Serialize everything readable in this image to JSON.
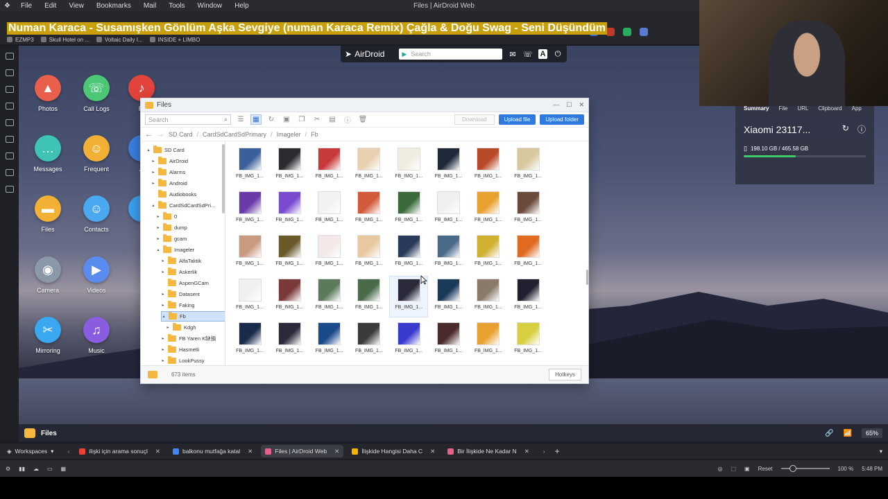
{
  "menubar": {
    "items": [
      "File",
      "Edit",
      "View",
      "Bookmarks",
      "Mail",
      "Tools",
      "Window",
      "Help"
    ],
    "window_title": "Files | AirDroid Web"
  },
  "overlay_text": "Numan Karaca - Susamışken Gönlüm Aşka Sevgiye (numan Karaca Remix) Çağla & Doğu Swag - Seni Düşündüm",
  "bookmarks": [
    "EZMP3",
    "Skull Hotel on ...",
    "Voltaic Daily I...",
    "INSIDE + LIMBO"
  ],
  "airdroid_bar": {
    "brand": "AirDroid",
    "search_placeholder": "Search"
  },
  "desktop_apps": [
    {
      "label": "Photos",
      "color": "#e8604c",
      "glyph": "▲"
    },
    {
      "label": "Call Logs",
      "color": "#4cc776",
      "glyph": "☏"
    },
    {
      "label": "Ri",
      "color": "#e2433a",
      "glyph": "♪"
    },
    {
      "label": "Messages",
      "color": "#3fc3b4",
      "glyph": "…"
    },
    {
      "label": "Frequent",
      "color": "#f2b035",
      "glyph": "☺"
    },
    {
      "label": "A",
      "color": "#3b7fe0",
      "glyph": ""
    },
    {
      "label": "Files",
      "color": "#f2b035",
      "glyph": "▬"
    },
    {
      "label": "Contacts",
      "color": "#4aa8f0",
      "glyph": "☺"
    },
    {
      "label": "",
      "color": "#3b9ff0",
      "glyph": ""
    },
    {
      "label": "Camera",
      "color": "#8a98a8",
      "glyph": "◉"
    },
    {
      "label": "Videos",
      "color": "#5a8cf0",
      "glyph": "▶"
    },
    {
      "label": "Mirroring",
      "color": "#3aa8f0",
      "glyph": "✂"
    },
    {
      "label": "Music",
      "color": "#8a5ce0",
      "glyph": "♫"
    }
  ],
  "right_panel": {
    "tabs": [
      "Summary",
      "File",
      "URL",
      "Clipboard",
      "App"
    ],
    "device": "Xiaomi 23117...",
    "storage": "198.10 GB / 465.58 GB",
    "storage_used_fraction": 0.425
  },
  "files_window": {
    "title": "Files",
    "search_placeholder": "Search",
    "download_label": "Download",
    "upload_file_label": "Upload file",
    "upload_folder_label": "Upload folder",
    "breadcrumb": [
      "SD Card",
      "CardSdCardSdPrimary",
      "Imageler",
      "Fb"
    ],
    "tree": [
      {
        "label": "SD Card",
        "arrow": "▴"
      },
      {
        "label": "AirDroid",
        "arrow": "▸"
      },
      {
        "label": "Alarms",
        "arrow": "▸"
      },
      {
        "label": "Android",
        "arrow": "▸"
      },
      {
        "label": "Audiobooks",
        "arrow": ""
      },
      {
        "label": "CardSdCardSdPri...",
        "arrow": "▴"
      },
      {
        "label": "0",
        "arrow": "▸"
      },
      {
        "label": "dump",
        "arrow": "▸"
      },
      {
        "label": "gcam",
        "arrow": "▸"
      },
      {
        "label": "Imageler",
        "arrow": "▴"
      },
      {
        "label": "AlfaTaktik",
        "arrow": "▸"
      },
      {
        "label": "Askerlik",
        "arrow": "▸"
      },
      {
        "label": "AspenGCam",
        "arrow": ""
      },
      {
        "label": "Datasent",
        "arrow": "▸"
      },
      {
        "label": "Faking",
        "arrow": "▸"
      },
      {
        "label": "Fb",
        "arrow": "▴"
      },
      {
        "label": "Kdgh",
        "arrow": "▸"
      },
      {
        "label": "FB Yaren K缺損",
        "arrow": "▸"
      },
      {
        "label": "Hasmetli",
        "arrow": "▸"
      },
      {
        "label": "LookPussy",
        "arrow": "▸"
      }
    ],
    "file_label": "FB_IMG_1...",
    "thumb_colors": [
      "#3a5f9a",
      "#2b2b30",
      "#c83a3a",
      "#e8d0b0",
      "#f0ece0",
      "#1e2a3a",
      "#b84a2a",
      "#d8c8a0",
      "#6a3aa8",
      "#7a4ad0",
      "#f2f2f2",
      "#d05a3a",
      "#3a6a3a",
      "#f0f0f0",
      "#e8a030",
      "#6a4a3a",
      "#c89a80",
      "#6a5a2a",
      "#f4e8e8",
      "#e8c8a0",
      "#2a3a5a",
      "#4a6a8a",
      "#d0b030",
      "#e06a20",
      "#f0f0f0",
      "#7a3a3a",
      "#5a7a5a",
      "#4a6a4a",
      "#2a2a3a",
      "#1a3a5a",
      "#8a7a6a",
      "#202030",
      "#1a2a4a",
      "#2a2a3a",
      "#1a4a8a",
      "#3a3a3a",
      "#3a3acf",
      "#4a2a2a",
      "#e8a030",
      "#d8d040"
    ],
    "item_count": "673 items",
    "hotkeys_label": "Hotkeys"
  },
  "dock": {
    "label": "Files",
    "battery": "65%"
  },
  "browser_tabs": {
    "workspaces_label": "Workspaces",
    "tabs": [
      {
        "label": "ilişki için arama sonuçl",
        "active": false
      },
      {
        "label": "balkonu mutfağa katal",
        "active": false
      },
      {
        "label": "Files | AirDroid Web",
        "active": true
      },
      {
        "label": "İlişkide Hangisi Daha C",
        "active": false
      },
      {
        "label": "Bir İlişkide Ne Kadar N",
        "active": false
      }
    ]
  },
  "statusbar": {
    "reset_label": "Reset",
    "zoom": "100 %",
    "time": "5:48 PM"
  }
}
